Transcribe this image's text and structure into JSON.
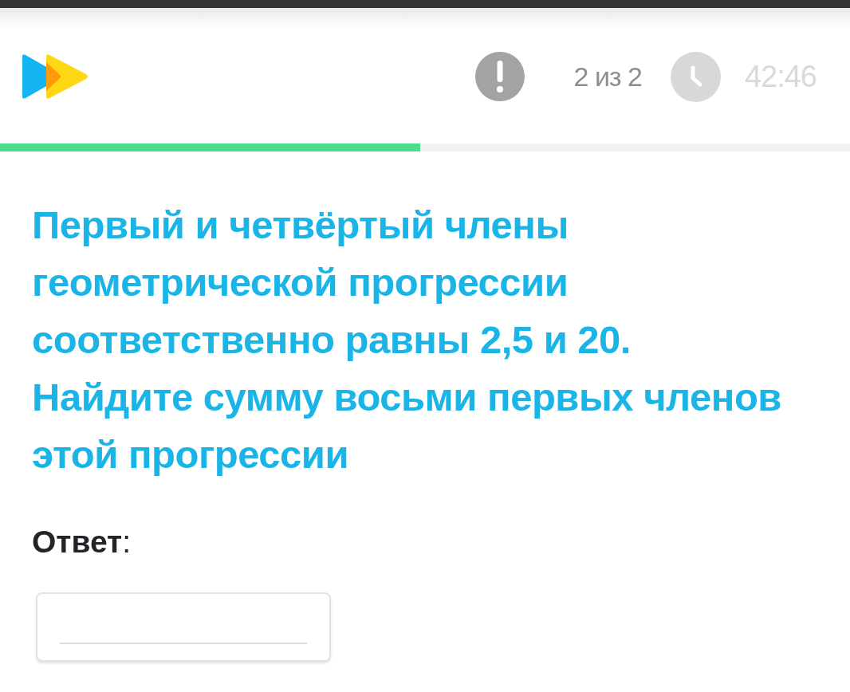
{
  "header": {
    "progress_counter": "2 из 2",
    "timer": "42:46"
  },
  "progress": {
    "level": 0.494
  },
  "question": {
    "text": "Первый и четвёртый члены геометрической прогрессии соответственно равны 2,5 и 20. Найдите сумму восьми первых членов этой прогрессии"
  },
  "answer": {
    "label": "**Ответ**:"
  }
}
